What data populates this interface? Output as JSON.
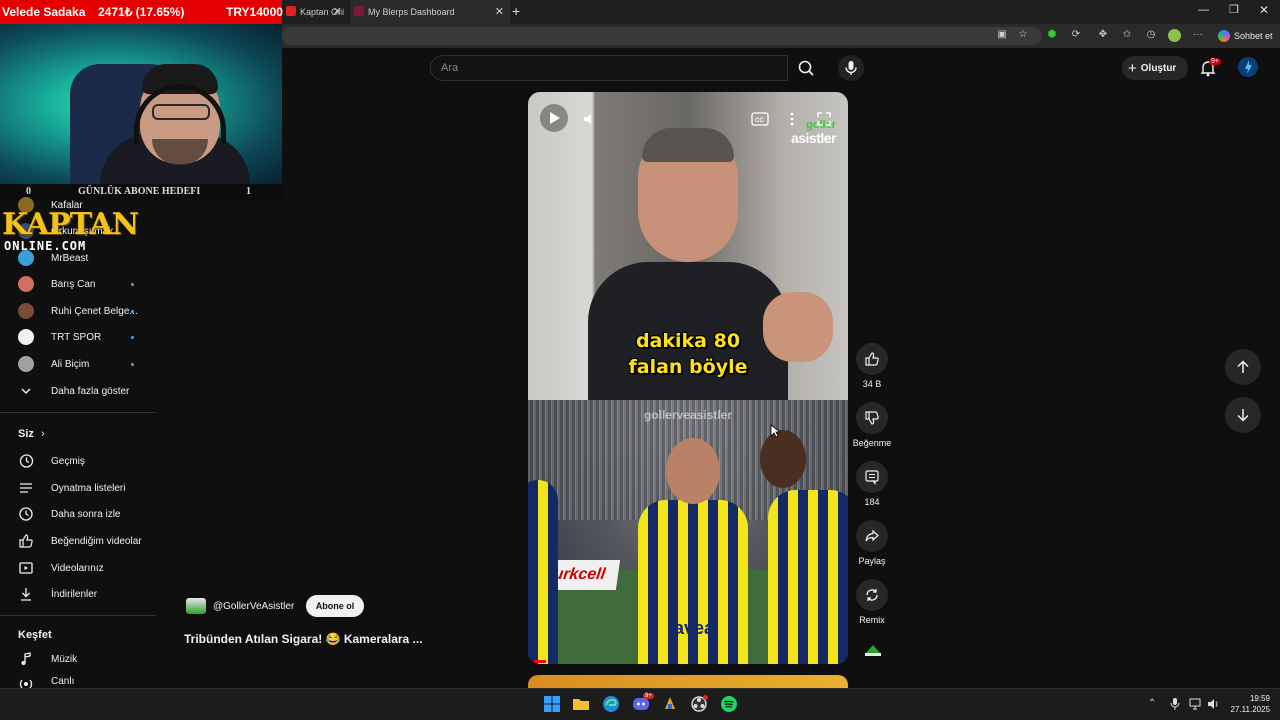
{
  "stream": {
    "donation_label": "Velede Sadaka",
    "donation_pct": "2471₺ (17.65%)",
    "donation_goal": "TRY14000",
    "goal_left": "0",
    "goal_title": "GÜNLÜK ABONE HEDEFI",
    "goal_right": "1",
    "logo_line1": "KAPTAN",
    "logo_line2": "ONLINE.COM"
  },
  "browser": {
    "tabs": [
      {
        "title": "Kaptan Online",
        "icon": "red-favicon"
      },
      {
        "title": "My Blerps Dashboard",
        "icon": "blerps-favicon"
      }
    ],
    "new_tab": "+",
    "chat_label": "Sohbet et"
  },
  "youtube": {
    "search_placeholder": "Ara",
    "create_label": "Oluştur",
    "notif_count": "9+"
  },
  "sidebar": {
    "subscriptions": [
      {
        "label": "Kafalar",
        "dot": false,
        "color": "#8a6a20"
      },
      {
        "label": "Orkun Işıtmak",
        "dot": false,
        "color": "#3a4a6a"
      },
      {
        "label": "MrBeast",
        "dot": false,
        "color": "#3aa0d8"
      },
      {
        "label": "Barış Can",
        "dot": true,
        "color": "#d07060"
      },
      {
        "label": "Ruhi Çenet Belge...",
        "dot": true,
        "color": "#7a4a3a"
      },
      {
        "label": "TRT SPOR",
        "dot": true,
        "color": "#f1f1f1"
      },
      {
        "label": "Ali Biçim",
        "dot": true,
        "color": "#a0a0a0"
      }
    ],
    "show_more": "Daha fazla göster",
    "you_header": "Siz",
    "you_items": [
      "Geçmiş",
      "Oynatma listeleri",
      "Daha sonra izle",
      "Beğendiğim videolar",
      "Videolarınız",
      "İndirilenler"
    ],
    "explore_header": "Keşfet",
    "explore_items": [
      "Müzik",
      "Canlı"
    ]
  },
  "short": {
    "caption_line1": "dakika 80",
    "caption_line2": "falan böyle",
    "watermark_top1": "goller",
    "watermark_top2": "asistler",
    "watermark_mid": "gollerveasistler",
    "sponsor_text": "Turkcell",
    "jersey_text": "avea",
    "channel_handle": "@GollerVeAsistler",
    "subscribe_label": "Abone ol",
    "title": "Tribünden Atılan Sigara! 😂 Kameralara ...",
    "progress": 0.04,
    "like_count": "34 B",
    "dislike_label": "Beğenme",
    "comment_count": "184",
    "share_label": "Paylaş",
    "remix_label": "Remix"
  },
  "taskbar": {
    "time": "19:59",
    "date": "27.11.2025",
    "discord_badge": "9+"
  }
}
